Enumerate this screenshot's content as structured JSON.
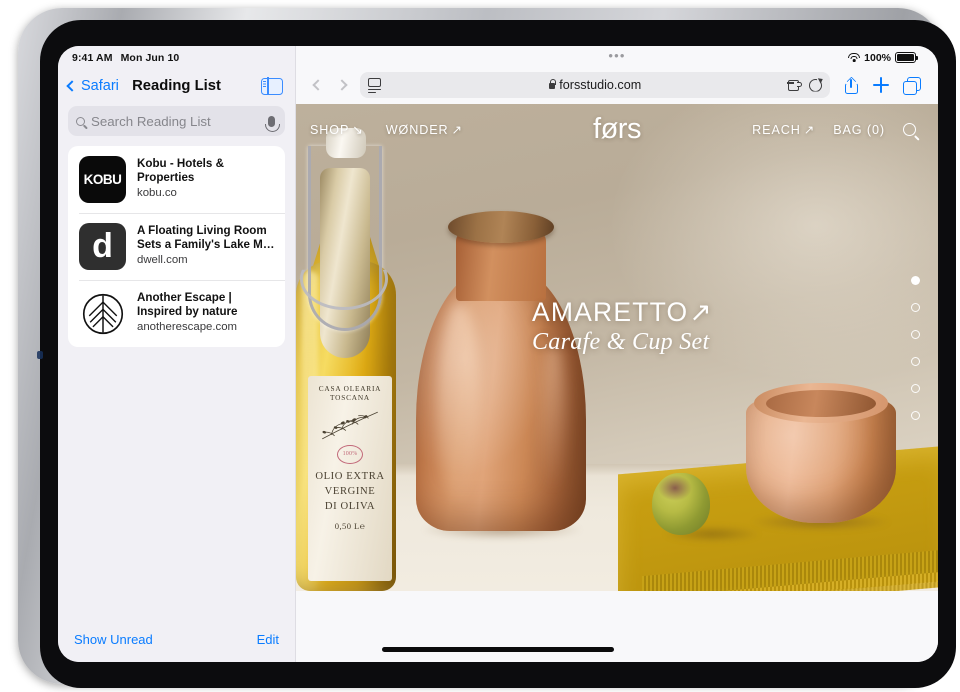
{
  "status_bar": {
    "time": "9:41 AM",
    "date": "Mon Jun 10",
    "battery_percent": "100%",
    "wifi_icon": "wifi-icon",
    "battery_icon": "battery-icon"
  },
  "sidebar": {
    "back_label": "Safari",
    "title": "Reading List",
    "toggle_icon": "sidebar-toggle-icon",
    "search": {
      "placeholder": "Search Reading List",
      "search_icon": "search-icon",
      "mic_icon": "microphone-icon"
    },
    "items": [
      {
        "title": "Kobu - Hotels & Properties",
        "url": "kobu.co",
        "favicon_text": "KOBU",
        "favicon_name": "kobu-favicon"
      },
      {
        "title": "A Floating Living Room Sets a Family's Lake M…",
        "url": "dwell.com",
        "favicon_text": "d",
        "favicon_name": "dwell-favicon"
      },
      {
        "title": "Another Escape | Inspired by nature",
        "url": "anotherescape.com",
        "favicon_text": "",
        "favicon_name": "another-escape-leaf-favicon"
      }
    ],
    "footer": {
      "show_unread": "Show Unread",
      "edit": "Edit"
    }
  },
  "browser": {
    "grabber": "•••",
    "back_icon": "chevron-left-icon",
    "forward_icon": "chevron-right-icon",
    "url": "forsstudio.com",
    "lock_icon": "lock-icon",
    "reader_icon": "page-settings-icon",
    "extension_icon": "extension-icon",
    "reload_icon": "reload-icon",
    "share_icon": "share-icon",
    "new_tab_icon": "plus-icon",
    "tabs_icon": "tab-overview-icon"
  },
  "website": {
    "brand": "førs",
    "nav_left": [
      {
        "label": "SHOP",
        "arrow": "↘",
        "name": "nav-shop"
      },
      {
        "label": "WØNDER",
        "arrow": "↗",
        "name": "nav-wonder"
      }
    ],
    "nav_right": [
      {
        "label": "REACH",
        "arrow": "↗",
        "name": "nav-reach"
      },
      {
        "label": "BAG (0)",
        "arrow": "",
        "name": "nav-bag"
      }
    ],
    "search_icon": "search-icon",
    "hero": {
      "title": "AMARETTO",
      "title_arrow": "↗",
      "subtitle": "Carafe & Cup Set"
    },
    "pagination": {
      "total": 6,
      "active_index": 0
    },
    "product_label": {
      "brand": "CASA OLEARIA TOSCANA",
      "seal": "100%",
      "line1": "OLIO EXTRA",
      "line2": "VERGINE",
      "line3": "DI OLIVA",
      "volume": "0,50 L℮"
    }
  },
  "colors": {
    "accent_blue": "#0a7cff",
    "sidebar_bg": "#f1f0f5",
    "toolbar_bg": "#f8f8fa",
    "hero_wall": "#bdb09c",
    "cloth_yellow": "#c49b10",
    "terracotta": "#d99a6b"
  }
}
